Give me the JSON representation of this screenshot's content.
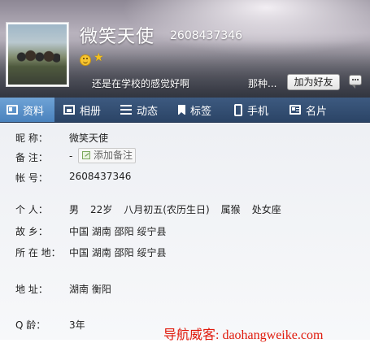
{
  "header": {
    "nickname": "微笑天使",
    "qq_number": "2608437346",
    "signature": "还是在学校的感觉好啊",
    "more_text": "那种...",
    "add_friend_label": "加为好友"
  },
  "tabs": [
    {
      "label": "资料",
      "icon": "profile-icon",
      "active": true
    },
    {
      "label": "相册",
      "icon": "album-icon"
    },
    {
      "label": "动态",
      "icon": "feed-icon"
    },
    {
      "label": "标签",
      "icon": "bookmark-icon"
    },
    {
      "label": "手机",
      "icon": "phone-icon"
    },
    {
      "label": "名片",
      "icon": "card-icon"
    }
  ],
  "profile": {
    "nickname_label": "昵    称：",
    "nickname_value": "微笑天使",
    "remark_label": "备    注：",
    "remark_value": "-",
    "add_remark_label": "添加备注",
    "account_label": "帐    号：",
    "account_value": "2608437346",
    "personal_label": "个    人：",
    "personal_gender": "男",
    "personal_age": "22岁",
    "personal_birthday": "八月初五(农历生日)",
    "personal_zodiac": "属猴",
    "personal_sign": "处女座",
    "hometown_label": "故    乡：",
    "hometown_value": "中国 湖南 邵阳 绥宁县",
    "location_label": "所 在 地：",
    "location_value": "中国 湖南 邵阳 绥宁县",
    "address_label": "地    址：",
    "address_value": "湖南   衡阳",
    "qage_label": "Q      龄：",
    "qage_value": "3年"
  },
  "watermark": "导航威客: daohangweike.com",
  "colors": {
    "tab_bar": "#2f4a6e",
    "tab_active": "#5b90c9",
    "watermark": "#e0190b"
  }
}
